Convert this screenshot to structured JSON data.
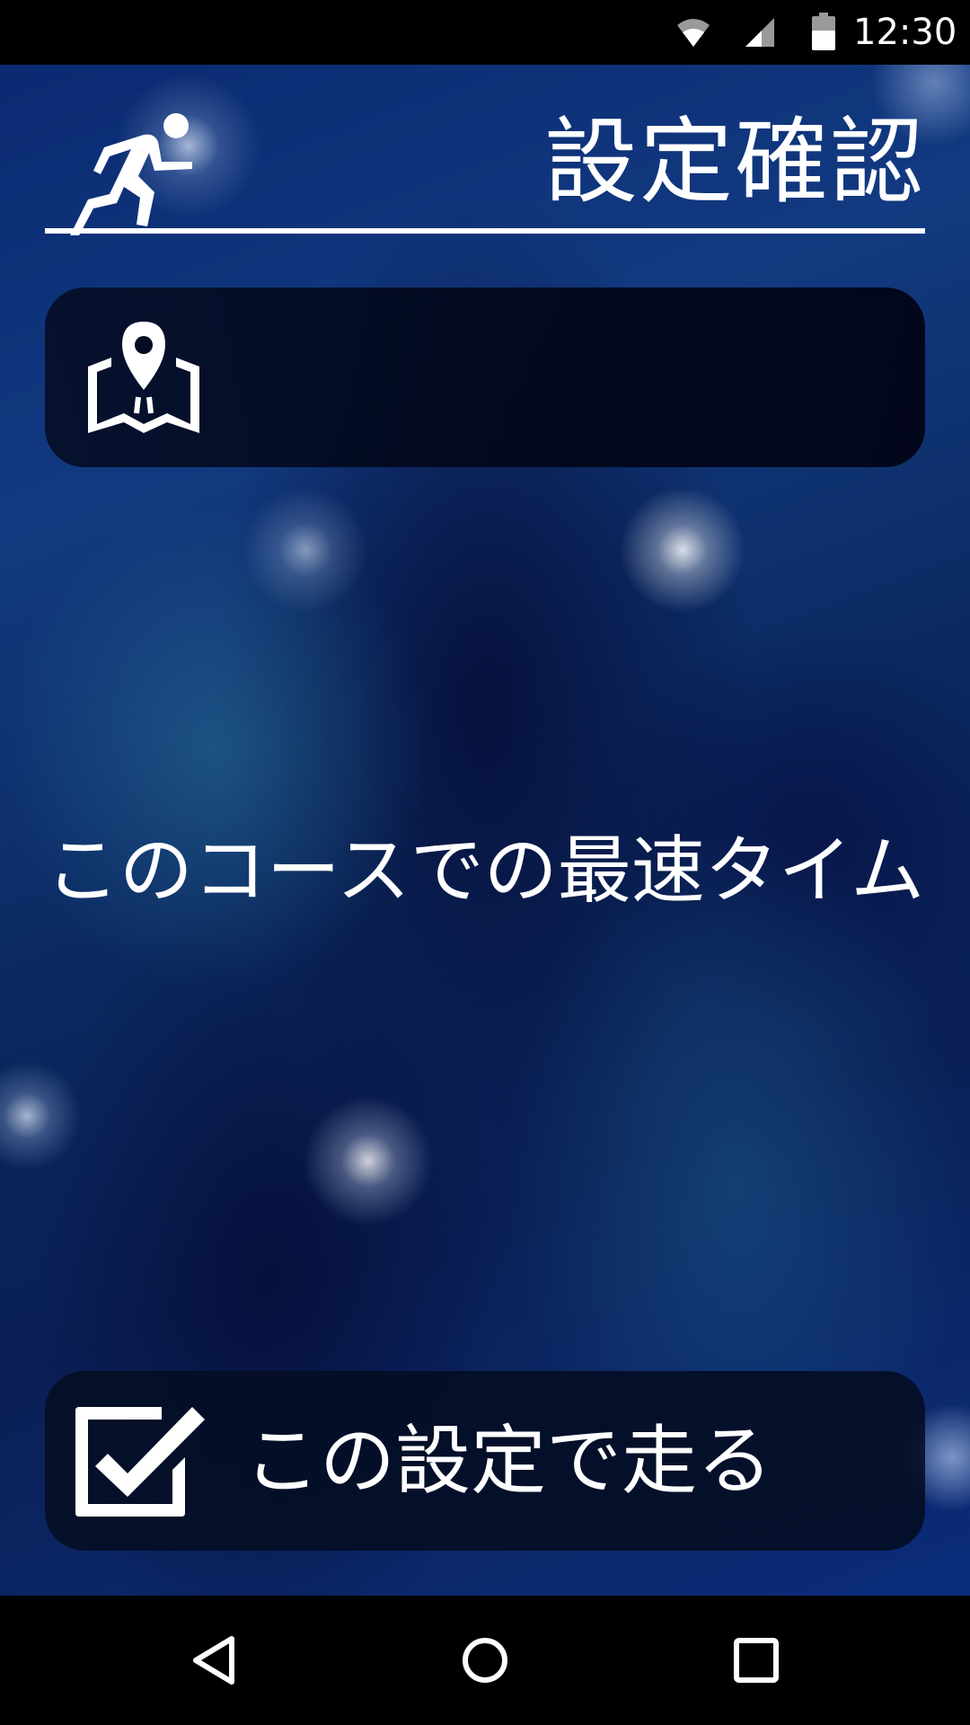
{
  "status_bar": {
    "time": "12:30",
    "icons": [
      "wifi-icon",
      "cell-signal-icon",
      "battery-icon"
    ]
  },
  "header": {
    "title": "設定確認",
    "icon": "runner-icon"
  },
  "course_card": {
    "icon": "map-pin-icon",
    "course_name": ""
  },
  "best_time": {
    "label": "このコースでの最速タイム",
    "value": ""
  },
  "run_button": {
    "icon": "checkbox-checked-icon",
    "label": "この設定で走る"
  },
  "nav_bar": {
    "buttons": [
      "back-icon",
      "home-icon",
      "recents-icon"
    ]
  },
  "colors": {
    "background": "#0b2960",
    "card": "#050c23",
    "text": "#ffffff"
  }
}
